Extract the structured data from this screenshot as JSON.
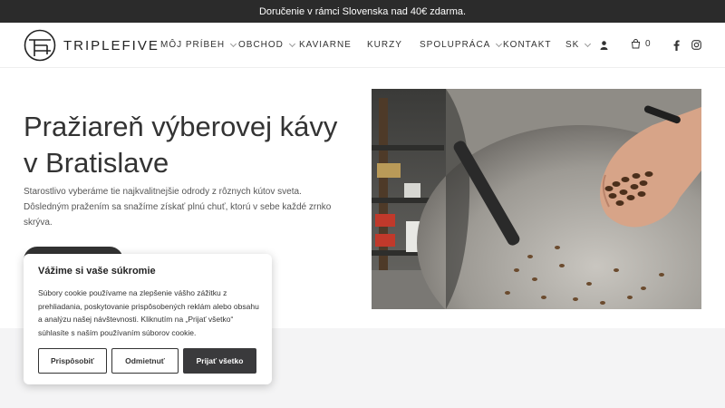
{
  "announcement": "Doručenie v rámci Slovenska nad 40€ zdarma.",
  "header": {
    "logo_text": "TRIPLEFIVE",
    "nav": [
      {
        "label": "MÔJ PRÍBEH",
        "has_caret": true
      },
      {
        "label": "OBCHOD",
        "has_caret": true
      },
      {
        "label": "KAVIARNE",
        "has_caret": false
      },
      {
        "label": "KURZY",
        "has_caret": false
      },
      {
        "label": "SPOLUPRÁCA",
        "has_caret": true
      },
      {
        "label": "KONTAKT",
        "has_caret": false
      }
    ],
    "language": "SK",
    "cart_count": "0",
    "icons": [
      "user-icon",
      "cart-icon",
      "facebook-icon",
      "instagram-icon"
    ]
  },
  "hero": {
    "title_line1": "Pražiareň výberovej kávy",
    "title_line2": "v Bratislave",
    "description": "Starostlivo vyberáme tie najkvalitnejšie odrody z rôznych kútov sveta. Dôsledným pražením sa snažíme získať plnú chuť, ktorú v sebe každé zrnko skrýva."
  },
  "cookie": {
    "title": "Vážime si vaše súkromie",
    "text": "Súbory cookie používame na zlepšenie vášho zážitku z prehliadania, poskytovanie prispôsobených reklám alebo obsahu a analýzu našej návštevnosti. Kliknutím na „Prijať všetko“ súhlasíte s naším používaním súborov cookie.",
    "customize_label": "Prispôsobiť",
    "reject_label": "Odmietnuť",
    "accept_label": "Prijať všetko"
  },
  "colors": {
    "topbar_bg": "#2b2b2b",
    "button_dark": "#3a3a3c",
    "band_bg": "#f4f4f5"
  }
}
